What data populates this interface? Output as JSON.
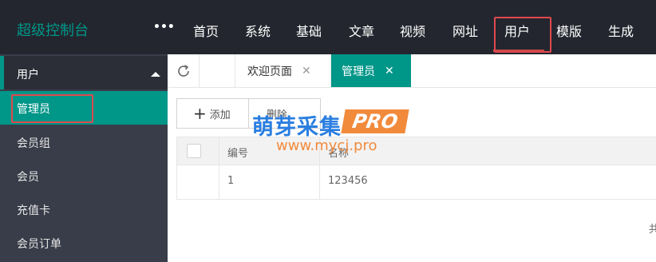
{
  "header": {
    "logo": "超级控制台",
    "more": "•••",
    "nav": [
      "首页",
      "系统",
      "基础",
      "文章",
      "视频",
      "网址",
      "用户",
      "模版",
      "生成"
    ],
    "active_nav": "用户"
  },
  "sidebar": {
    "group_label": "用户",
    "items": [
      "管理员",
      "会员组",
      "会员",
      "充值卡",
      "会员订单"
    ],
    "active_item": "管理员"
  },
  "tabs": {
    "items": [
      {
        "label": "欢迎页面",
        "close": "✕"
      },
      {
        "label": "管理员",
        "close": "✕"
      }
    ],
    "active_tab": "管理员"
  },
  "toolbar": {
    "add_label": "添加",
    "delete_label": "删除"
  },
  "table": {
    "columns": [
      "编号",
      "名称"
    ],
    "rows": [
      [
        "1",
        "123456"
      ]
    ]
  },
  "pagination": {
    "text": "共"
  },
  "watermark": {
    "title": "萌芽采集",
    "badge": "PRO",
    "url": "www.mycj.pro"
  },
  "colors": {
    "topbar": "#23262e",
    "sidebar": "#393d49",
    "accent": "#009688",
    "highlight_box": "#e0484f"
  }
}
